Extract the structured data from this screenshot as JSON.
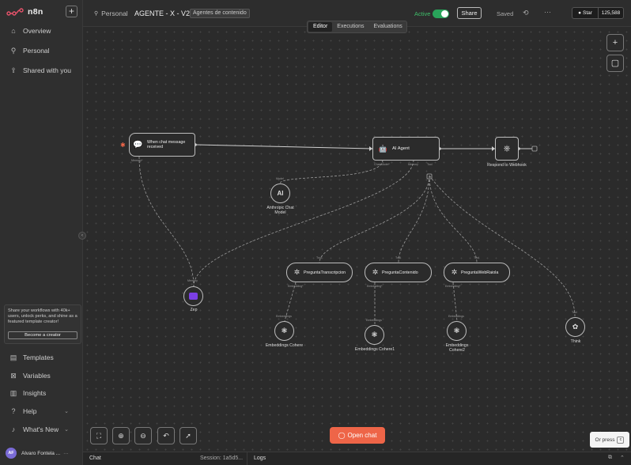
{
  "brand": {
    "name": "n8n",
    "new_button": "+"
  },
  "sidebar": {
    "items": [
      {
        "label": "Overview",
        "icon": "home-icon"
      },
      {
        "label": "Personal",
        "icon": "user-icon"
      },
      {
        "label": "Shared with you",
        "icon": "share-icon"
      }
    ],
    "bottom_items": [
      {
        "label": "Templates",
        "icon": "templates-icon"
      },
      {
        "label": "Variables",
        "icon": "variables-icon"
      },
      {
        "label": "Insights",
        "icon": "insights-icon"
      },
      {
        "label": "Help",
        "icon": "help-icon",
        "chevron": "⌄"
      },
      {
        "label": "What's New",
        "icon": "bell-icon",
        "chevron": "⌄"
      }
    ],
    "promo": {
      "text": "Share your workflows with 40k+ users, unlock perks, and shine as a featured template creator!",
      "button": "Become a creator"
    },
    "user": {
      "initials": "AF",
      "name": "Alvaro Fontela ...",
      "more": "···"
    },
    "collapse": "‹"
  },
  "header": {
    "project": "Personal",
    "workflow_title": "AGENTE - X - V2",
    "tag": "Agentes de contenido",
    "active_label": "Active",
    "share_label": "Share",
    "saved_label": "Saved",
    "more": "···",
    "github": {
      "star_label": "Star",
      "count": "125,588"
    }
  },
  "tabs": [
    {
      "label": "Editor",
      "selected": true
    },
    {
      "label": "Executions",
      "selected": false
    },
    {
      "label": "Evaluations",
      "selected": false
    }
  ],
  "nodes": {
    "trigger": {
      "title": "When chat message received",
      "port": "Memory*"
    },
    "agent": {
      "title": "AI Agent",
      "ports": [
        "Chat Model*",
        "Memory",
        "Tool"
      ]
    },
    "respond": {
      "title": "Respond to Webhook"
    },
    "anthropic": {
      "title": "Anthropic Chat Model",
      "port": "Model"
    },
    "zep": {
      "title": "Zep",
      "port": "Memory"
    },
    "tool1": {
      "title": "PreguntaTranscripcion",
      "port_in": "Tool",
      "port_out": "Embedding*"
    },
    "tool2": {
      "title": "PreguntaContenido",
      "port_in": "Tool",
      "port_out": "Embedding*"
    },
    "tool3": {
      "title": "PreguntaWebRaiola",
      "port_in": "Tool",
      "port_out": "Embedding*"
    },
    "emb1": {
      "title": "Embeddings Cohere",
      "port": "Embeddings"
    },
    "emb2": {
      "title": "Embeddings Cohere1",
      "port": "Embeddings"
    },
    "emb3": {
      "title": "Embeddings Cohere2",
      "port": "Embeddings"
    },
    "think": {
      "title": "Think",
      "port": "Tool"
    }
  },
  "toolbar": {
    "open_chat": "Open chat",
    "or_press": "Or press",
    "key": "c"
  },
  "bottom_panel": {
    "chat": "Chat",
    "session": "Session: 1a5d5...",
    "logs": "Logs"
  },
  "colors": {
    "accent": "#ee6548",
    "active": "#29a35a",
    "zep": "#7b3fe4"
  }
}
